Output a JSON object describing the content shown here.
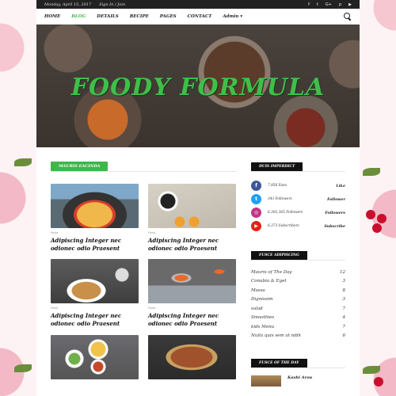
{
  "topbar": {
    "date": "Monday, April 15, 2017",
    "signin": "Sign In / Join",
    "social_icons": [
      "f",
      "t",
      "G+",
      "p",
      "▶"
    ]
  },
  "nav": {
    "items": [
      "HOME",
      "BLOG",
      "DETAILS",
      "RECIPE",
      "PAGES",
      "CONTACT",
      "Admin ▾"
    ],
    "active_index": 1
  },
  "hero": {
    "title": "FOODY FORMULA"
  },
  "main": {
    "section_label": "MAURIS EACINDA",
    "posts": [
      {
        "category": "Pasta",
        "title": "Adipiscing Integer nec odionec odio Praesent"
      },
      {
        "category": "Pasta",
        "title": "Adipiscing Integer nec odionec odio Praesent"
      },
      {
        "category": "Pasta",
        "title": "Adipiscing Integer nec odionec odio Praesent"
      },
      {
        "category": "Pasta",
        "title": "Adipiscing Integer nec odionec odio Praesent"
      },
      {
        "category": "",
        "title": ""
      },
      {
        "category": "",
        "title": ""
      }
    ]
  },
  "sidebar": {
    "social_label": "DUIS IMPERDICT",
    "socials": [
      {
        "icon": "f",
        "color": "#3b5998",
        "count": "7,856 Fans",
        "action": "Like"
      },
      {
        "icon": "t",
        "color": "#1da1f2",
        "count": "343 Followers",
        "action": "Follower"
      },
      {
        "icon": "◎",
        "color": "#c13584",
        "count": "6,392,365 Followers",
        "action": "Followers"
      },
      {
        "icon": "▶",
        "color": "#e62117",
        "count": "6,373 Subscribers",
        "action": "Subscribe"
      }
    ],
    "categories_label": "FUSCE ADIPISCING",
    "categories": [
      {
        "name": "Mauris of The Day",
        "count": "12"
      },
      {
        "name": "Conubia & Eget",
        "count": "3"
      },
      {
        "name": "Massa",
        "count": "8"
      },
      {
        "name": "Dignissim",
        "count": "3"
      },
      {
        "name": "salad",
        "count": "7"
      },
      {
        "name": "Smoothies",
        "count": "4"
      },
      {
        "name": "kids Menu",
        "count": "7"
      },
      {
        "name": "Nulla quis sem at nibh",
        "count": "6"
      }
    ],
    "recipe_label": "FUSCE OF THE DAY",
    "recipe_name": "Kashi Arou"
  }
}
